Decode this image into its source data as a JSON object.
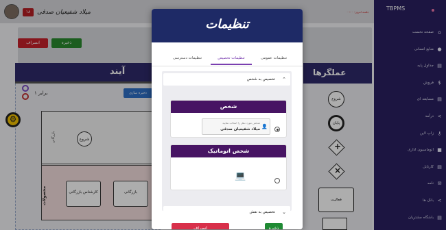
{
  "header": {
    "badge": "۱۸",
    "username": "میلاد شفیعیان صدقی",
    "top_right_text": "جلسه امروز: ۰۰:۰۰"
  },
  "sidebar": {
    "brand": "TBPMS",
    "items": [
      {
        "label": "صفحه نخست",
        "icon": "home-icon"
      },
      {
        "label": "منابع انسانی",
        "icon": "person-icon"
      },
      {
        "label": "جداول پایه",
        "icon": "document-icon"
      },
      {
        "label": "فروش",
        "icon": "dollar-icon"
      },
      {
        "label": "مسابقه ای",
        "icon": "document-icon"
      },
      {
        "label": "درآمد",
        "icon": "share-icon"
      },
      {
        "label": "زاپ لاین",
        "icon": "key-icon"
      },
      {
        "label": "اتوماسیون اداری",
        "icon": "lock-icon"
      },
      {
        "label": "کارتابل",
        "icon": "document-icon"
      },
      {
        "label": "نامه",
        "icon": "mail-icon"
      },
      {
        "label": "بانک ها",
        "icon": "share-icon"
      },
      {
        "label": "باشگاه مشتریان",
        "icon": "document-icon"
      }
    ]
  },
  "background": {
    "save_label": "ذخیره",
    "cancel_label": "انصراف",
    "process_title": "آیند",
    "zoom_level": "۱ برابر",
    "download_label": "ذخیره سازی",
    "pool_label": "محصولات",
    "lane_label": "بازرگانی",
    "start_event_label": "شروع",
    "task1_label": "کارشناس بازرگانی",
    "task2_label": "بازرگانی",
    "actors_title": "عملگرها",
    "shape_start": "شروع",
    "shape_end": "پایان",
    "shape_activity": "فعالیت"
  },
  "modal": {
    "title": "تنظیمات",
    "tabs": [
      {
        "label": "تنظیمات عمومی",
        "active": false
      },
      {
        "label": "تنظیمات تخصیص",
        "active": true
      },
      {
        "label": "تنظیمات دسترسی",
        "active": false
      }
    ],
    "accordion1_title": "تخصیص به شخص",
    "person_card": {
      "title": "شخص",
      "hint": "شخص مورد نظر را انتخاب نمایید",
      "selected": "میلاد شفیعیان صدقی",
      "checked": true
    },
    "auto_card": {
      "title": "شخص اتوماتیک",
      "checked": false
    },
    "accordion2_title": "تخصیص به نقش",
    "cancel_label": "انصراف",
    "save_label": "ذخیره"
  }
}
